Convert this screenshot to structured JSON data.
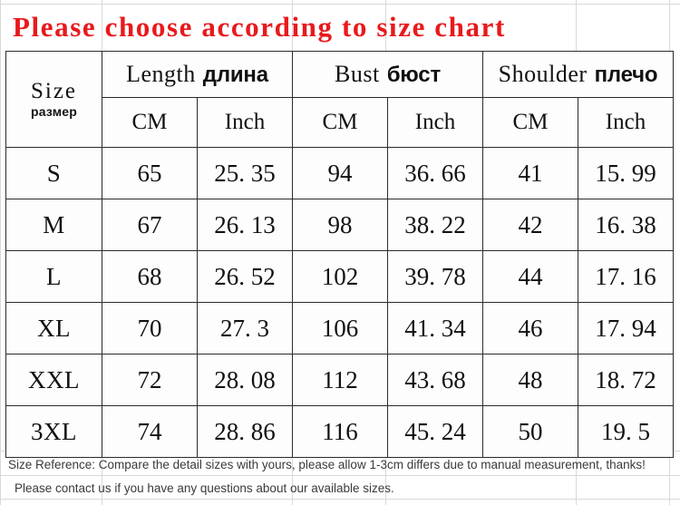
{
  "title": "Please choose according to size chart",
  "title_color": "#e8191c",
  "table": {
    "size_header": {
      "en": "Size",
      "ru": "размер"
    },
    "groups": [
      {
        "en": "Length",
        "ru": "длина"
      },
      {
        "en": "Bust",
        "ru": "бюст"
      },
      {
        "en": "Shoulder",
        "ru": "плечо"
      }
    ],
    "units": [
      "CM",
      "Inch",
      "CM",
      "Inch",
      "CM",
      "Inch"
    ],
    "rows": [
      {
        "size": "S",
        "cells": [
          "65",
          "25. 35",
          "94",
          "36. 66",
          "41",
          "15. 99"
        ]
      },
      {
        "size": "M",
        "cells": [
          "67",
          "26. 13",
          "98",
          "38. 22",
          "42",
          "16. 38"
        ]
      },
      {
        "size": "L",
        "cells": [
          "68",
          "26. 52",
          "102",
          "39. 78",
          "44",
          "17. 16"
        ]
      },
      {
        "size": "XL",
        "cells": [
          "70",
          "27. 3",
          "106",
          "41. 34",
          "46",
          "17. 94"
        ]
      },
      {
        "size": "XXL",
        "cells": [
          "72",
          "28. 08",
          "112",
          "43. 68",
          "48",
          "18. 72"
        ]
      },
      {
        "size": "3XL",
        "cells": [
          "74",
          "28. 86",
          "116",
          "45. 24",
          "50",
          "19. 5"
        ]
      }
    ]
  },
  "notes": [
    "Size Reference: Compare the detail sizes with yours, please allow 1-3cm differs due to manual measurement, thanks!",
    "Please contact us if you have any questions about our available sizes."
  ],
  "chart_data": {
    "type": "table",
    "title": "Please choose according to size chart",
    "columns": [
      "Size размер",
      "Length длина CM",
      "Length длина Inch",
      "Bust бюст CM",
      "Bust бюст Inch",
      "Shoulder плечо CM",
      "Shoulder плечо Inch"
    ],
    "rows": [
      [
        "S",
        65,
        25.35,
        94,
        36.66,
        41,
        15.99
      ],
      [
        "M",
        67,
        26.13,
        98,
        38.22,
        42,
        16.38
      ],
      [
        "L",
        68,
        26.52,
        102,
        39.78,
        44,
        17.16
      ],
      [
        "XL",
        70,
        27.3,
        106,
        41.34,
        46,
        17.94
      ],
      [
        "XXL",
        72,
        28.08,
        112,
        43.68,
        48,
        18.72
      ],
      [
        "3XL",
        74,
        28.86,
        116,
        45.24,
        50,
        19.5
      ]
    ]
  }
}
